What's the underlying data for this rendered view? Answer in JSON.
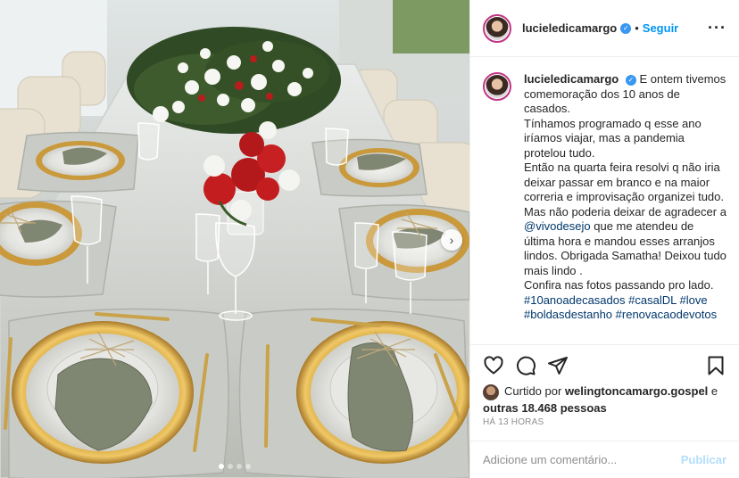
{
  "post": {
    "username": "lucieledicamargo",
    "separator": "•",
    "follow_label": "Seguir",
    "more_icon": "more-horizontal-icon",
    "caption_lines": [
      "E ontem tivemos comemoração dos 10 anos de casados.",
      "Tínhamos programado q esse ano iríamos viajar, mas a pandemia protelou tudo.",
      "Então na quarta feira resolvi q não iria deixar passar em branco e na maior correria e improvisação organizei tudo.",
      "Mas não poderia deixar de agradecer a",
      "que me atendeu de última hora e mandou esses arranjos lindos. Obrigada Samatha! Deixou tudo mais lindo .",
      "Confira nas fotos passando pro lado."
    ],
    "mention": "@vivodesejo",
    "hashtags": [
      "#10anoadecasados",
      "#casalDL",
      "#love",
      "#boldasdestanho",
      "#renovacaodevotos"
    ],
    "liked_by_prefix": "Curtido por",
    "liked_by_user": "welingtoncamargo.gospel",
    "liked_by_connector": "e",
    "liked_by_others": "outras 18.468 pessoas",
    "time": "HÁ 13 HORAS",
    "comment_placeholder": "Adicione um comentário...",
    "publish_label": "Publicar",
    "colors": {
      "link": "#0095f6",
      "tag": "#00376b",
      "muted": "#8e8e8e",
      "avatar_ring": "#c13584"
    },
    "carousel": {
      "slides": 4,
      "active": 1
    }
  }
}
